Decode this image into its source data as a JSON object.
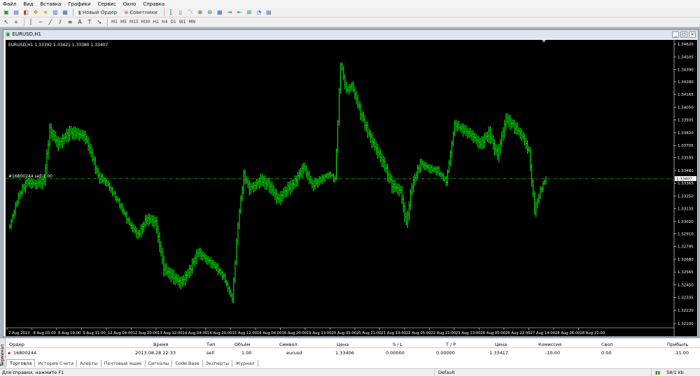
{
  "menu": [
    "Файл",
    "Вид",
    "Вставка",
    "Графики",
    "Сервис",
    "Окно",
    "Справка"
  ],
  "toolbar": {
    "new_order": "Новый Ордер",
    "advisors": "Советники",
    "timeframes": [
      "M1",
      "M5",
      "M15",
      "M30",
      "H1",
      "H4",
      "D1",
      "W1",
      "MN"
    ]
  },
  "chart": {
    "window_title": "EURUSD,H1",
    "info_label": "EURUSD,H1  1.33392 1.33421 1.33380 1.33407",
    "order_label": "#16800244 sell 1.00",
    "bg_color": "#000000",
    "candle_color": "#00ff00",
    "axis_color": "#ffffff"
  },
  "chart_data": {
    "type": "candlestick",
    "y_ticks": [
      "1.34620",
      "1.34505",
      "1.34390",
      "1.34280",
      "1.34165",
      "1.34050",
      "1.33935",
      "1.33820",
      "1.33705",
      "1.33595",
      "1.33480",
      "1.33365",
      "1.33250",
      "1.33135",
      "1.33020",
      "1.32910",
      "1.32795",
      "1.32680",
      "1.32565",
      "1.32450",
      "1.32335",
      "1.32220",
      "1.32100"
    ],
    "ylim": [
      1.321,
      1.3462
    ],
    "current_price": "1.33407",
    "order_price": 1.33406,
    "x_ticks": [
      "7 Aug 2013",
      "8 Aug 03:00",
      "8 Aug 19:00",
      "9 Aug 11:00",
      "12 Aug 04:00",
      "12 Aug 20:00",
      "13 Aug 12:00",
      "14 Aug 04:00",
      "14 Aug 20:00",
      "15 Aug 12:00",
      "16 Aug 04:00",
      "16 Aug 20:00",
      "19 Aug 13:00",
      "20 Aug 05:00",
      "20 Aug 21:00",
      "21 Aug 13:00",
      "22 Aug 05:00",
      "22 Aug 21:00",
      "23 Aug 13:00",
      "26 Aug 05:00",
      "26 Aug 22:00",
      "27 Aug 14:00",
      "28 Aug 06:00",
      "28 Aug 22:00"
    ],
    "close_path": [
      [
        0,
        1.3298
      ],
      [
        3,
        1.3325
      ],
      [
        6,
        1.3338
      ],
      [
        9,
        1.3336
      ],
      [
        12,
        1.3339
      ],
      [
        14,
        1.3385
      ],
      [
        17,
        1.3372
      ],
      [
        21,
        1.3383
      ],
      [
        26,
        1.338
      ],
      [
        28,
        1.3368
      ],
      [
        31,
        1.3343
      ],
      [
        34,
        1.3337
      ],
      [
        38,
        1.332
      ],
      [
        42,
        1.33
      ],
      [
        45,
        1.329
      ],
      [
        48,
        1.3305
      ],
      [
        51,
        1.3302
      ],
      [
        54,
        1.326
      ],
      [
        57,
        1.3253
      ],
      [
        60,
        1.3247
      ],
      [
        63,
        1.3258
      ],
      [
        66,
        1.3275
      ],
      [
        69,
        1.3268
      ],
      [
        72,
        1.3262
      ],
      [
        75,
        1.3252
      ],
      [
        78,
        1.3232
      ],
      [
        80,
        1.33
      ],
      [
        82,
        1.3344
      ],
      [
        84,
        1.3332
      ],
      [
        86,
        1.3335
      ],
      [
        88,
        1.334
      ],
      [
        91,
        1.3335
      ],
      [
        94,
        1.3322
      ],
      [
        97,
        1.3331
      ],
      [
        100,
        1.3338
      ],
      [
        103,
        1.3352
      ],
      [
        106,
        1.3335
      ],
      [
        109,
        1.334
      ],
      [
        112,
        1.3345
      ],
      [
        114,
        1.334
      ],
      [
        116,
        1.3445
      ],
      [
        118,
        1.342
      ],
      [
        120,
        1.3425
      ],
      [
        123,
        1.34
      ],
      [
        126,
        1.338
      ],
      [
        128,
        1.337
      ],
      [
        131,
        1.3355
      ],
      [
        134,
        1.3335
      ],
      [
        137,
        1.333
      ],
      [
        139,
        1.33
      ],
      [
        141,
        1.3335
      ],
      [
        144,
        1.3355
      ],
      [
        147,
        1.335
      ],
      [
        150,
        1.3348
      ],
      [
        153,
        1.3338
      ],
      [
        156,
        1.339
      ],
      [
        159,
        1.3385
      ],
      [
        162,
        1.338
      ],
      [
        165,
        1.3372
      ],
      [
        168,
        1.3382
      ],
      [
        171,
        1.3362
      ],
      [
        174,
        1.3395
      ],
      [
        177,
        1.3388
      ],
      [
        180,
        1.3378
      ],
      [
        182,
        1.3365
      ],
      [
        184,
        1.3312
      ],
      [
        186,
        1.333
      ],
      [
        188,
        1.3341
      ]
    ]
  },
  "terminal": {
    "side_label": "Терминал",
    "columns": [
      "Ордер",
      "Время",
      "Тип",
      "Объём",
      "Символ",
      "Цена",
      "S / L",
      "T / P",
      "Цена",
      "Комиссия",
      "Своп",
      "Прибыль"
    ],
    "row": [
      "16800244",
      "2013.08.28 22:33",
      "sell",
      "1.00",
      "eurusd",
      "1.33406",
      "0.00000",
      "0.00000",
      "1.33417",
      "-10.00",
      "0.00",
      "-11.00"
    ],
    "tabs": [
      "Торговля",
      "История Счета",
      "Алерты",
      "Почтовый ящик",
      "Сигналы",
      "Code Base",
      "Эксперты",
      "Журнал"
    ]
  },
  "status": {
    "help": "Для справки, нажмите F1",
    "profile": "Default",
    "traffic": "58/1 kb"
  }
}
